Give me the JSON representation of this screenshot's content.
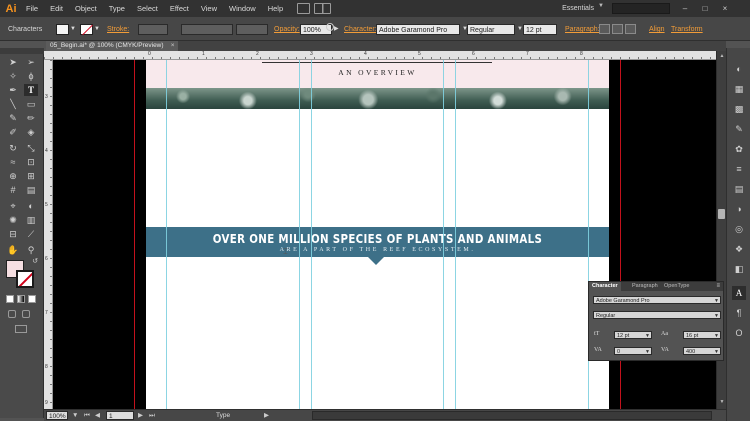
{
  "app": {
    "logo": "Ai",
    "menus": [
      "File",
      "Edit",
      "Object",
      "Type",
      "Select",
      "Effect",
      "View",
      "Window",
      "Help"
    ],
    "workspace": "Essentials",
    "window_buttons": [
      "–",
      "□",
      "×"
    ]
  },
  "control_bar": {
    "object_type": "Characters",
    "stroke_label": "Stroke:",
    "opacity_label": "Opacity:",
    "opacity_value": "100%",
    "character_label": "Character:",
    "font_family": "Adobe Garamond Pro",
    "font_style": "Regular",
    "font_size": "12 pt",
    "paragraph_label": "Paragraph:",
    "align_label": "Align",
    "transform_label": "Transform"
  },
  "document": {
    "tab_title": "05_Begin.ai* @ 100% (CMYK/Preview)",
    "close_glyph": "×"
  },
  "rulers": {
    "horizontal_labels": [
      "0",
      "1",
      "2",
      "3",
      "4",
      "5",
      "6",
      "7",
      "8"
    ],
    "vertical_labels": [
      "3",
      "4",
      "5",
      "6",
      "7",
      "8",
      "9"
    ]
  },
  "artboard": {
    "overview_title": "AN OVERVIEW",
    "headline": "OVER ONE MILLION SPECIES OF PLANTS AND ANIMALS",
    "subhead": "ARE A PART OF THE REEF ECOSYSTEM.",
    "band_color": "#3d7088",
    "header_tint": "#f8e9ec"
  },
  "status_bar": {
    "zoom": "100%",
    "page": "1",
    "tool": "Type"
  },
  "character_panel": {
    "tabs": [
      "Character",
      "Paragraph",
      "OpenType"
    ],
    "font_family": "Adobe Garamond Pro",
    "font_style": "Regular",
    "font_size": "12 pt",
    "leading": "16 pt",
    "kerning": "0",
    "tracking": "400"
  },
  "colors": {
    "accent_orange": "#f29c38",
    "bleed_red": "#c3111c",
    "guide_cyan": "#7fd0e0"
  }
}
